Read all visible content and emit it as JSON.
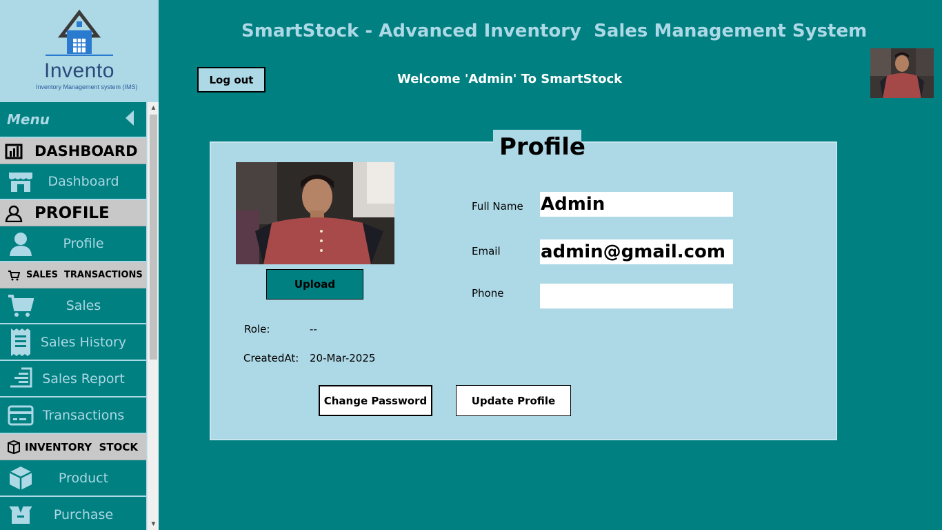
{
  "app": {
    "title": "SmartStock - Advanced Inventory  Sales Management System",
    "welcome": "Welcome 'Admin' To SmartStock",
    "logout_label": "Log out"
  },
  "logo": {
    "name": "Invento",
    "subtitle": "Inventory Management system (IMS)"
  },
  "sidebar": {
    "menu_label": "Menu",
    "sections": [
      {
        "label": "DASHBOARD",
        "icon": "bar-chart-icon"
      },
      {
        "label": "PROFILE",
        "icon": "user-outline-icon"
      },
      {
        "label": "SALES  TRANSACTIONS",
        "icon": "cart-icon"
      },
      {
        "label": "INVENTORY  STOCK",
        "icon": "box-outline-icon"
      }
    ],
    "items": [
      {
        "label": "Dashboard",
        "icon": "store-icon"
      },
      {
        "label": "Profile",
        "icon": "person-icon"
      },
      {
        "label": "Sales",
        "icon": "shopping-cart-icon"
      },
      {
        "label": "Sales History",
        "icon": "receipt-icon"
      },
      {
        "label": "Sales Report",
        "icon": "report-icon"
      },
      {
        "label": "Transactions",
        "icon": "credit-card-icon"
      },
      {
        "label": "Product",
        "icon": "cube-icon"
      },
      {
        "label": "Purchase",
        "icon": "open-box-icon"
      }
    ]
  },
  "profile": {
    "title": "Profile",
    "upload_label": "Upload",
    "role_label": "Role:",
    "role_value": "--",
    "created_label": "CreatedAt:",
    "created_value": "20-Mar-2025",
    "fullname_label": "Full Name",
    "fullname_value": "Admin",
    "email_label": "Email",
    "email_value": "admin@gmail.com",
    "phone_label": "Phone",
    "phone_value": "",
    "change_password_label": "Change Password",
    "update_profile_label": "Update Profile"
  },
  "colors": {
    "background": "#008080",
    "panel": "#add8e6",
    "section_gray": "#c8c8c8"
  }
}
